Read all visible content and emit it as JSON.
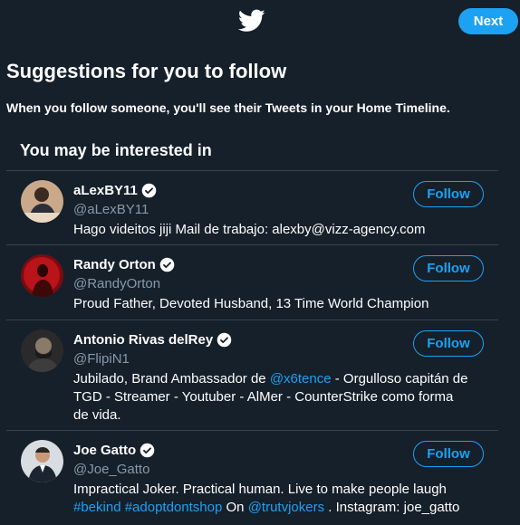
{
  "header": {
    "logo_icon": "twitter-bird-icon",
    "next_label": "Next",
    "accent": "#1da1f2"
  },
  "title": "Suggestions for you to follow",
  "subtitle": "When you follow someone, you'll see their Tweets in your Home Timeline.",
  "section_title": "You may be interested in",
  "follow_label": "Follow",
  "users": [
    {
      "name": "aLexBY11",
      "handle": "@aLexBY11",
      "verified": true,
      "bio": [
        {
          "text": "Hago videitos jiji Mail de trabajo: alexby@vizz-agency.com"
        }
      ]
    },
    {
      "name": "Randy Orton",
      "handle": "@RandyOrton",
      "verified": true,
      "bio": [
        {
          "text": "Proud Father, Devoted Husband, 13 Time World Champion"
        }
      ]
    },
    {
      "name": "Antonio Rivas delRey",
      "handle": "@FlipiN1",
      "verified": true,
      "bio": [
        {
          "text": "Jubilado, Brand Ambassador de "
        },
        {
          "text": "@x6tence",
          "link": true
        },
        {
          "text": " - Orgulloso capitán de TGD - Streamer - Youtuber - AlMer - CounterStrike como forma de vida."
        }
      ]
    },
    {
      "name": "Joe Gatto",
      "handle": "@Joe_Gatto",
      "verified": true,
      "bio": [
        {
          "text": "Impractical Joker. Practical human. Live to make people laugh "
        },
        {
          "text": "#bekind",
          "link": true
        },
        {
          "text": " "
        },
        {
          "text": "#adoptdontshop",
          "link": true
        },
        {
          "text": " On "
        },
        {
          "text": "@trutvjokers",
          "link": true
        },
        {
          "text": " . Instagram: joe_gatto"
        }
      ]
    }
  ]
}
